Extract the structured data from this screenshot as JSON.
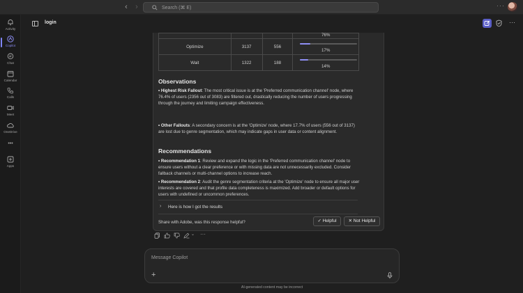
{
  "titlebar": {
    "search_placeholder": "Search (⌘ E)"
  },
  "rail": {
    "items": [
      {
        "label": "Activity",
        "icon": "bell-icon"
      },
      {
        "label": "Copilot",
        "icon": "copilot-icon"
      },
      {
        "label": "Chat",
        "icon": "chat-icon"
      },
      {
        "label": "Calendar",
        "icon": "calendar-icon"
      },
      {
        "label": "Calls",
        "icon": "phone-icon"
      },
      {
        "label": "Meet",
        "icon": "video-icon"
      },
      {
        "label": "OneDrive",
        "icon": "cloud-icon"
      },
      {
        "label": "Apps",
        "icon": "plus-box-icon"
      }
    ],
    "more_label": "•••"
  },
  "header": {
    "title": "login"
  },
  "table": {
    "rows": [
      {
        "name": "",
        "total": "",
        "passed": "",
        "percent": "76%",
        "fill": 0.76
      },
      {
        "name": "Optimize",
        "total": "3137",
        "passed": "556",
        "percent": "17%",
        "fill": 0.177
      },
      {
        "name": "Wait",
        "total": "1322",
        "passed": "188",
        "percent": "14%",
        "fill": 0.142
      }
    ]
  },
  "observations": {
    "heading": "Observations",
    "p1_label": "• Highest Risk Fallout",
    "p1_text": ": The most critical issue is at the 'Preferred communication channel' node, where 76.4% of users (2356 out of 3083) are filtered out, drastically reducing the number of users progressing through the journey and limiting campaign effectiveness.",
    "p2_label": "• Other Fallouts",
    "p2_text": ": A secondary concern is at the 'Optimize' node, where 17.7% of users (556 out of 3137) are lost due to genre segmentation, which may indicate gaps in user data or content alignment."
  },
  "recommendations": {
    "heading": "Recommendations",
    "p1_label": "• Recommendation 1",
    "p1_text": ": Review and expand the logic in the 'Preferred communication channel' node to ensure users without a clear preference or with missing data are not unnecessarily excluded. Consider fallback channels or multi-channel options to increase reach.",
    "p2_label": "• Recommendation 2",
    "p2_text": ": Audit the genre segmentation criteria at the 'Optimize' node to ensure all major user interests are covered and that profile data completeness is maximized. Add broader or default options for users with undefined or uncommon preferences."
  },
  "expander": {
    "label": "Here is how I got the results"
  },
  "feedback": {
    "question": "Share with Adobe, was this response helpful?",
    "helpful": "✓ Helpful",
    "not_helpful": "✕ Not Helpful"
  },
  "composer": {
    "placeholder": "Message Copilot",
    "disclaimer": "AI-generated content may be incorrect"
  },
  "colors": {
    "accent": "#5b5fc7",
    "bar": "#8f8ff5"
  }
}
